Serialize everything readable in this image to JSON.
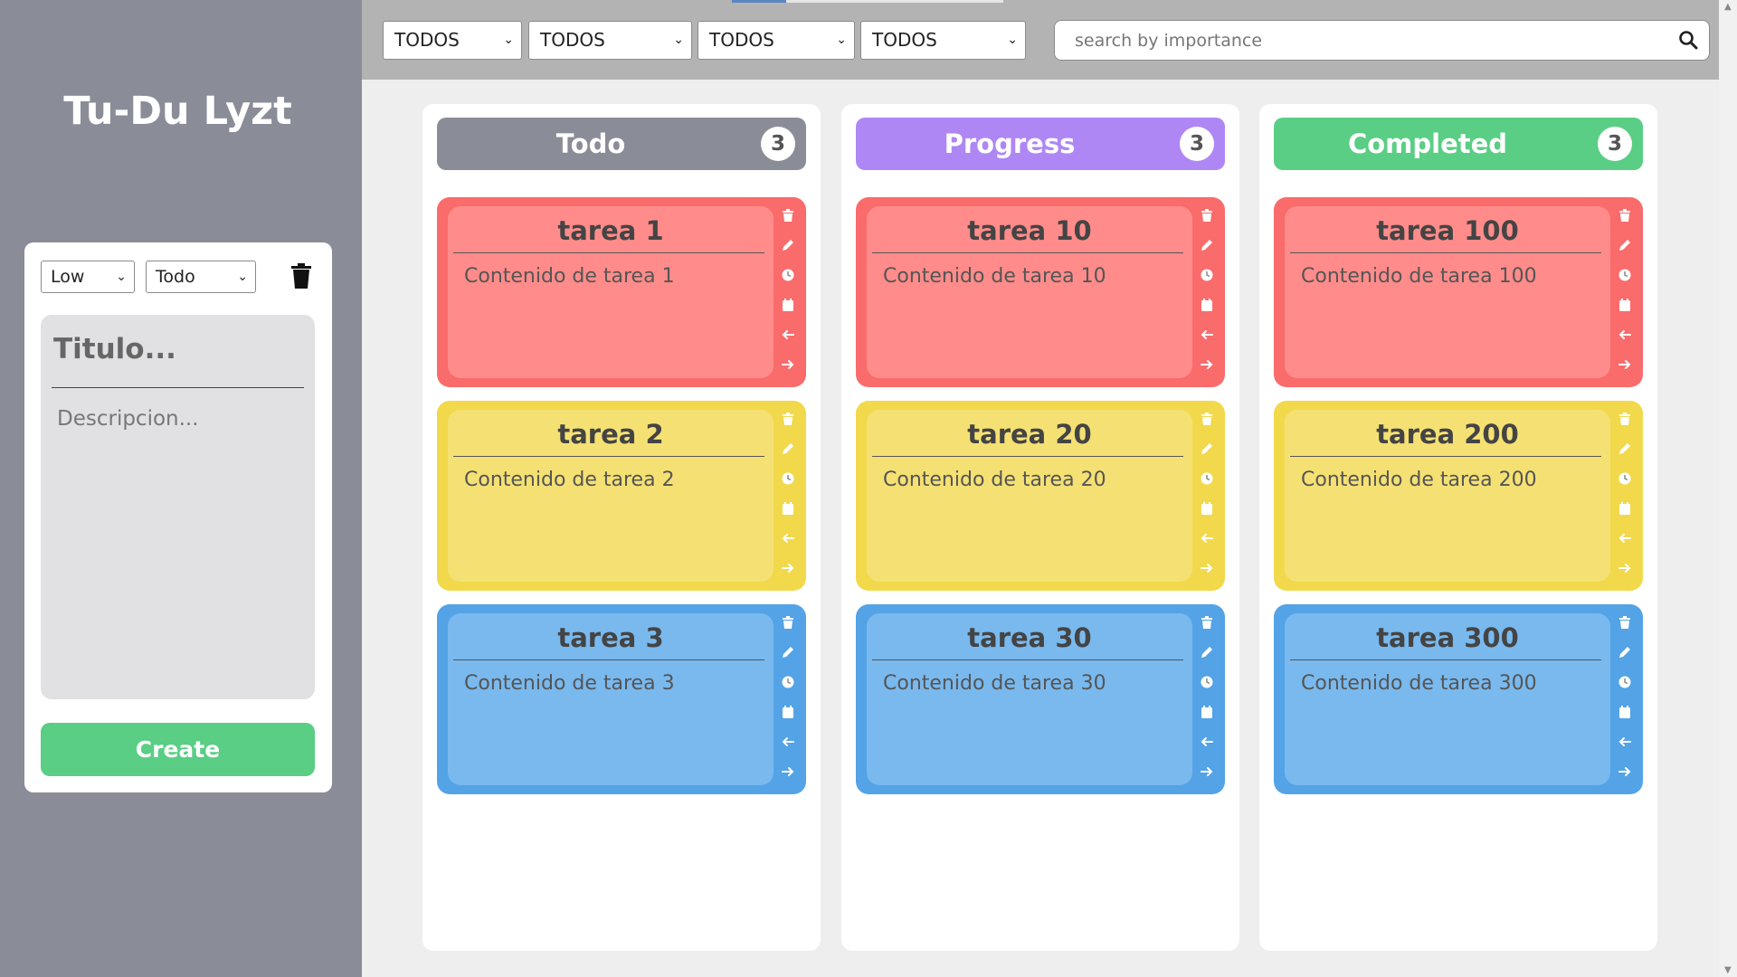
{
  "app": {
    "title": "Tu-Du Lyzt"
  },
  "create_panel": {
    "priority_value": "Low",
    "state_value": "Todo",
    "title_placeholder": "Titulo...",
    "description_placeholder": "Descripcion...",
    "create_label": "Create"
  },
  "filters": [
    "TODOS",
    "TODOS",
    "TODOS",
    "TODOS"
  ],
  "search": {
    "placeholder": "search by importance"
  },
  "columns": [
    {
      "title": "Todo",
      "count": "3",
      "color": "#8a8d97",
      "cards": [
        {
          "title": "tarea 1",
          "content": "Contenido de tarea 1",
          "color": "red"
        },
        {
          "title": "tarea 2",
          "content": "Contenido de tarea 2",
          "color": "yellow"
        },
        {
          "title": "tarea 3",
          "content": "Contenido de tarea 3",
          "color": "blue"
        }
      ]
    },
    {
      "title": "Progress",
      "count": "3",
      "color": "#ae87f4",
      "cards": [
        {
          "title": "tarea 10",
          "content": "Contenido de tarea 10",
          "color": "red"
        },
        {
          "title": "tarea 20",
          "content": "Contenido de tarea 20",
          "color": "yellow"
        },
        {
          "title": "tarea 30",
          "content": "Contenido de tarea 30",
          "color": "blue"
        }
      ]
    },
    {
      "title": "Completed",
      "count": "3",
      "color": "#5ace84",
      "cards": [
        {
          "title": "tarea 100",
          "content": "Contenido de tarea 100",
          "color": "red"
        },
        {
          "title": "tarea 200",
          "content": "Contenido de tarea 200",
          "color": "yellow"
        },
        {
          "title": "tarea 300",
          "content": "Contenido de tarea 300",
          "color": "blue"
        }
      ]
    }
  ],
  "card_actions": [
    "trash-icon",
    "pencil-icon",
    "clock-icon",
    "calendar-icon",
    "arrow-left-icon",
    "arrow-right-icon"
  ]
}
